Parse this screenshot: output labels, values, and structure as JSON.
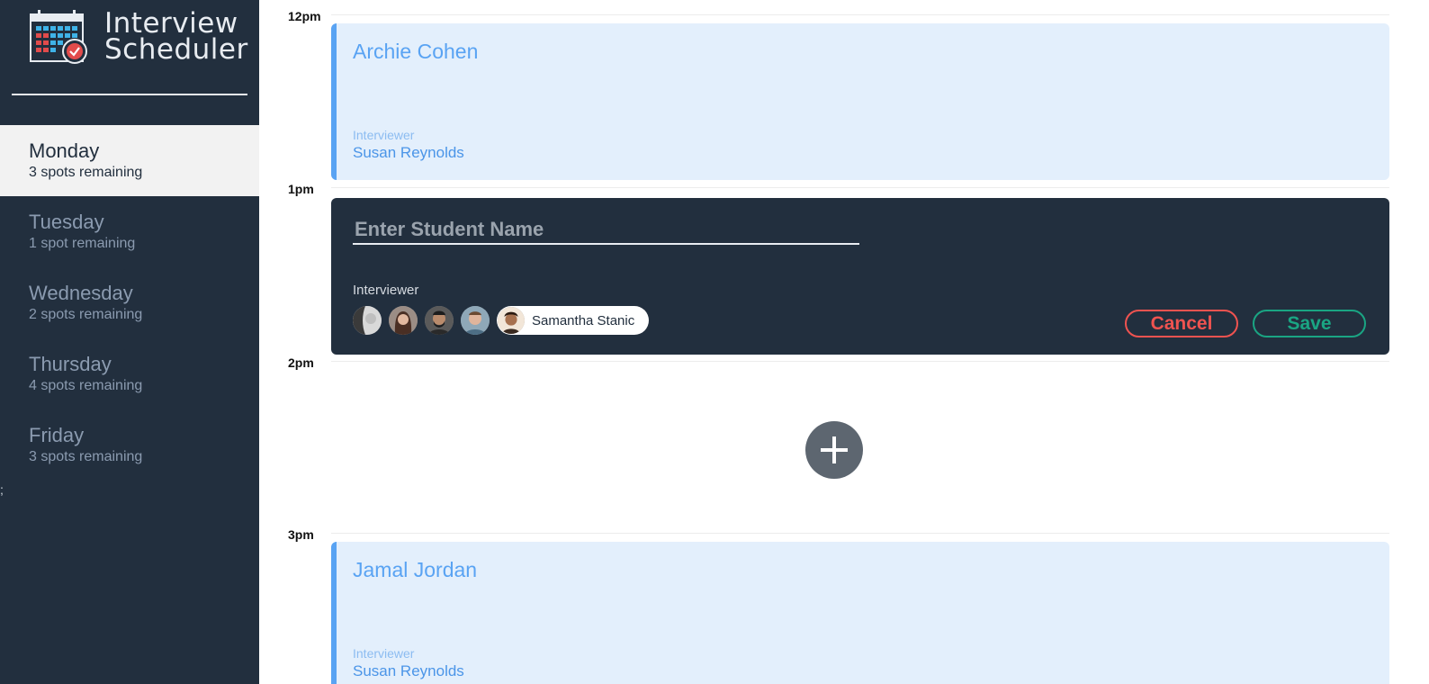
{
  "app": {
    "title_line1": "Interview",
    "title_line2": "Scheduler"
  },
  "days": [
    {
      "name": "Monday",
      "spots": "3 spots remaining",
      "selected": true
    },
    {
      "name": "Tuesday",
      "spots": "1 spot remaining",
      "selected": false
    },
    {
      "name": "Wednesday",
      "spots": "2 spots remaining",
      "selected": false
    },
    {
      "name": "Thursday",
      "spots": "4 spots remaining",
      "selected": false
    },
    {
      "name": "Friday",
      "spots": "3 spots remaining",
      "selected": false
    }
  ],
  "stray_mark": ";",
  "schedule": {
    "times": [
      "12pm",
      "1pm",
      "2pm",
      "3pm"
    ],
    "appointments": [
      {
        "student": "Archie Cohen",
        "interviewer_label": "Interviewer",
        "interviewer": "Susan Reynolds"
      },
      {
        "student": "Jamal Jordan",
        "interviewer_label": "Interviewer",
        "interviewer": "Susan Reynolds"
      }
    ],
    "form": {
      "student_value": "",
      "student_placeholder": "Enter Student Name",
      "interviewer_label": "Interviewer",
      "selected_interviewer": "Samantha Stanic",
      "cancel_label": "Cancel",
      "save_label": "Save"
    }
  },
  "colors": {
    "sidebar_bg": "#222f3e",
    "appointment_bg": "#e3effc",
    "appointment_accent": "#59a3f3",
    "cancel": "#ef5350",
    "save": "#1aa583",
    "add_button": "#5d6670"
  },
  "icons": {
    "logo": "calendar-check-icon",
    "add": "plus-icon"
  }
}
